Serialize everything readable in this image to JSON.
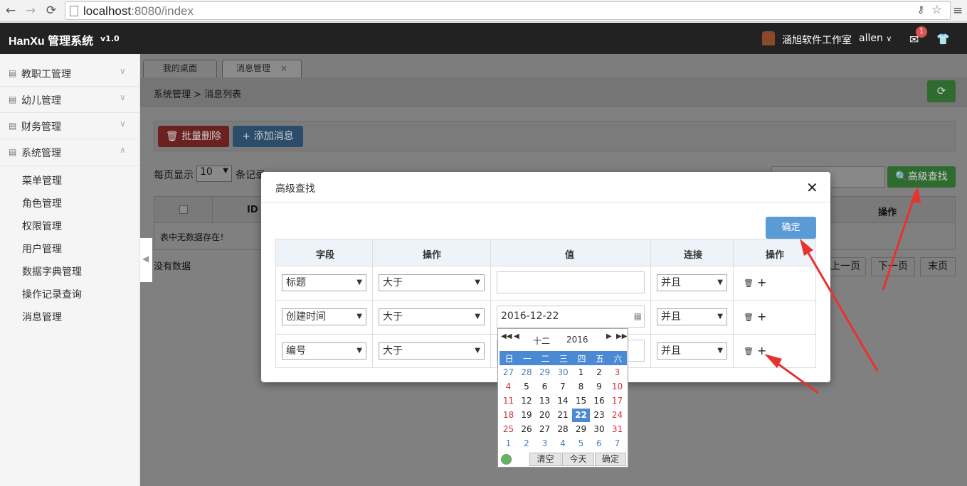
{
  "browser": {
    "url_host": "localhost",
    "url_rest": ":8080/index"
  },
  "header": {
    "brand": "HanXu 管理系统",
    "version": "v1.0",
    "studio": "涵旭软件工作室",
    "user": "allen",
    "mail_count": "1"
  },
  "sidebar": {
    "menus": [
      {
        "label": "教职工管理"
      },
      {
        "label": "幼儿管理"
      },
      {
        "label": "财务管理"
      },
      {
        "label": "系统管理"
      }
    ],
    "submenus": [
      {
        "label": "菜单管理"
      },
      {
        "label": "角色管理"
      },
      {
        "label": "权限管理"
      },
      {
        "label": "用户管理"
      },
      {
        "label": "数据字典管理"
      },
      {
        "label": "操作记录查询"
      },
      {
        "label": "消息管理"
      }
    ]
  },
  "tabs": [
    {
      "label": "我的桌面"
    },
    {
      "label": "消息管理"
    }
  ],
  "breadcrumb": "系统管理  >  消息列表",
  "toolbar": {
    "delete_label": "批量删除",
    "add_label": "添加消息"
  },
  "list": {
    "pagesize_label": "每页显示",
    "pagesize_value": "10",
    "records_label": "条记录",
    "adv_search_label": "高级查找",
    "col_id": "ID",
    "col_op": "操作",
    "empty_text": "表中无数据存在！",
    "nodata": "没有数据",
    "pager": {
      "prev": "上一页",
      "next": "下一页",
      "last": "末页"
    }
  },
  "modal": {
    "title": "高级查找",
    "confirm": "确定",
    "headers": [
      "字段",
      "操作",
      "值",
      "连接",
      "操作"
    ],
    "rows": [
      {
        "field": "标题",
        "op": "大于",
        "value": "",
        "conn": "并且"
      },
      {
        "field": "创建时间",
        "op": "大于",
        "value": "2016-12-22",
        "conn": "并且"
      },
      {
        "field": "编号",
        "op": "大于",
        "value": "",
        "conn": "并且"
      }
    ]
  },
  "calendar": {
    "month": "十二",
    "year": "2016",
    "weekdays": [
      "日",
      "一",
      "二",
      "三",
      "四",
      "五",
      "六"
    ],
    "weeks": [
      [
        "27",
        "28",
        "29",
        "30",
        "1",
        "2",
        "3"
      ],
      [
        "4",
        "5",
        "6",
        "7",
        "8",
        "9",
        "10"
      ],
      [
        "11",
        "12",
        "13",
        "14",
        "15",
        "16",
        "17"
      ],
      [
        "18",
        "19",
        "20",
        "21",
        "22",
        "23",
        "24"
      ],
      [
        "25",
        "26",
        "27",
        "28",
        "29",
        "30",
        "31"
      ],
      [
        "1",
        "2",
        "3",
        "4",
        "5",
        "6",
        "7"
      ]
    ],
    "selected": "22",
    "clear": "清空",
    "today": "今天",
    "ok": "确定"
  },
  "colors": {
    "header_bg": "#222222",
    "primary": "#5b9bd5",
    "success": "#5cb85c",
    "danger": "#d9534f",
    "arrow": "#e8322d"
  }
}
